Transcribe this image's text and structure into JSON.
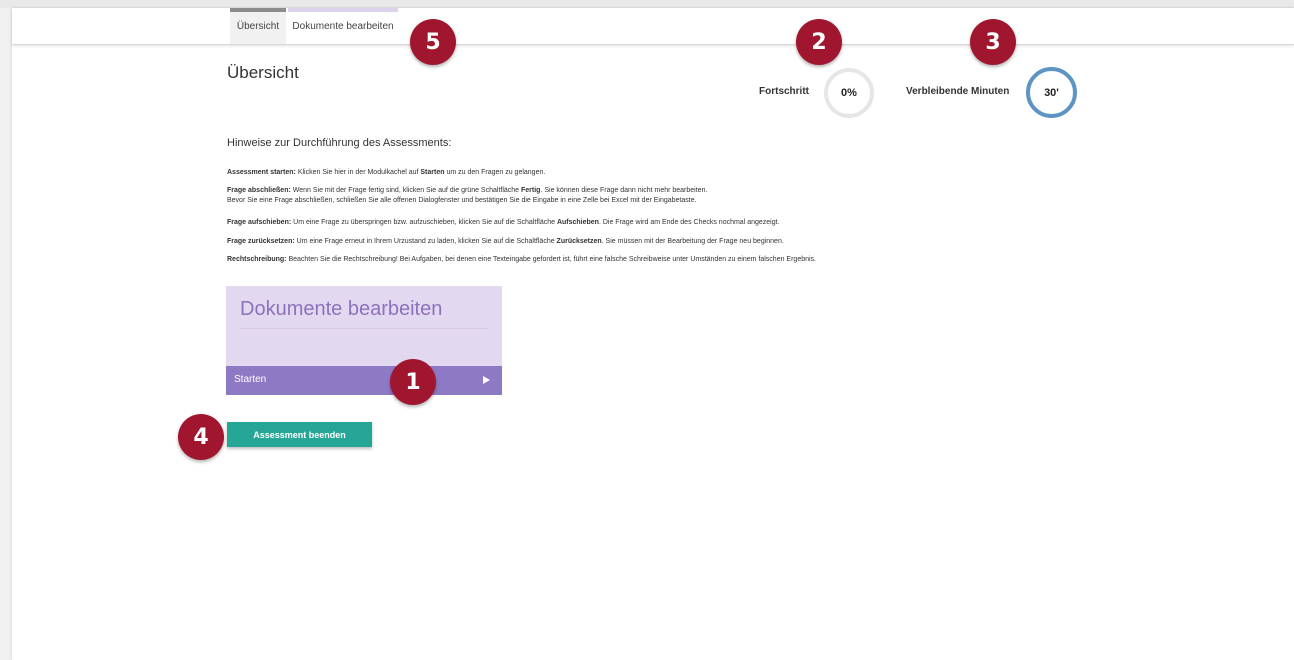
{
  "tabs": [
    {
      "label": "Übersicht"
    },
    {
      "label": "Dokumente bearbeiten"
    }
  ],
  "page_title": "Übersicht",
  "progress": {
    "label": "Fortschritt",
    "value": "0%"
  },
  "remaining": {
    "label": "Verbleibende Minuten",
    "value": "30'"
  },
  "hints": {
    "heading": "Hinweise zur Durchführung des Assessments:",
    "items": [
      {
        "bold": "Assessment starten:",
        "text": " Klicken Sie hier in der Modulkachel auf ",
        "bold2": "Starten",
        "text2": " um zu den Fragen zu gelangen."
      },
      {
        "bold": "Frage abschließen:",
        "text": " Wenn Sie mit der Frage fertig sind, klicken Sie auf die grüne Schaltfläche ",
        "bold2": "Fertig",
        "text2": ". Sie können diese Frage dann nicht mehr bearbeiten.",
        "line2": "Bevor Sie eine Frage abschließen, schließen Sie alle offenen Dialogfenster und bestätigen Sie die Eingabe in eine Zelle bei Excel mit der Eingabetaste."
      },
      {
        "bold": "Frage aufschieben:",
        "text": " Um eine Frage zu überspringen bzw. aufzuschieben, klicken Sie auf die Schaltfläche ",
        "bold2": "Aufschieben",
        "text2": ". Die Frage wird am Ende des Checks nochmal angezeigt."
      },
      {
        "bold": "Frage zurücksetzen:",
        "text": " Um eine Frage erneut in Ihrem Urzustand zu laden, klicken Sie auf die Schaltfläche ",
        "bold2": "Zurücksetzen",
        "text2": ". Sie müssen mit der Bearbeitung der Frage neu beginnen."
      },
      {
        "bold": "Rechtschreibung:",
        "text": " Beachten Sie die Rechtschreibung! Bei Aufgaben, bei denen eine Texteingabe gefordert ist, führt eine falsche Schreibweise unter Umständen zu einem falschen Ergebnis."
      }
    ]
  },
  "module_tile": {
    "title": "Dokumente bearbeiten",
    "start_label": "Starten",
    "icon": "play-icon"
  },
  "end_button": {
    "label": "Assessment beenden"
  },
  "badges": [
    "1",
    "2",
    "3",
    "4",
    "5"
  ],
  "colors": {
    "tile_bg": "#e2d9f0",
    "tile_bar": "#8e79c5",
    "end_button": "#26a696",
    "badge": "#a0162f",
    "timer_ring": "#5e94c3"
  }
}
